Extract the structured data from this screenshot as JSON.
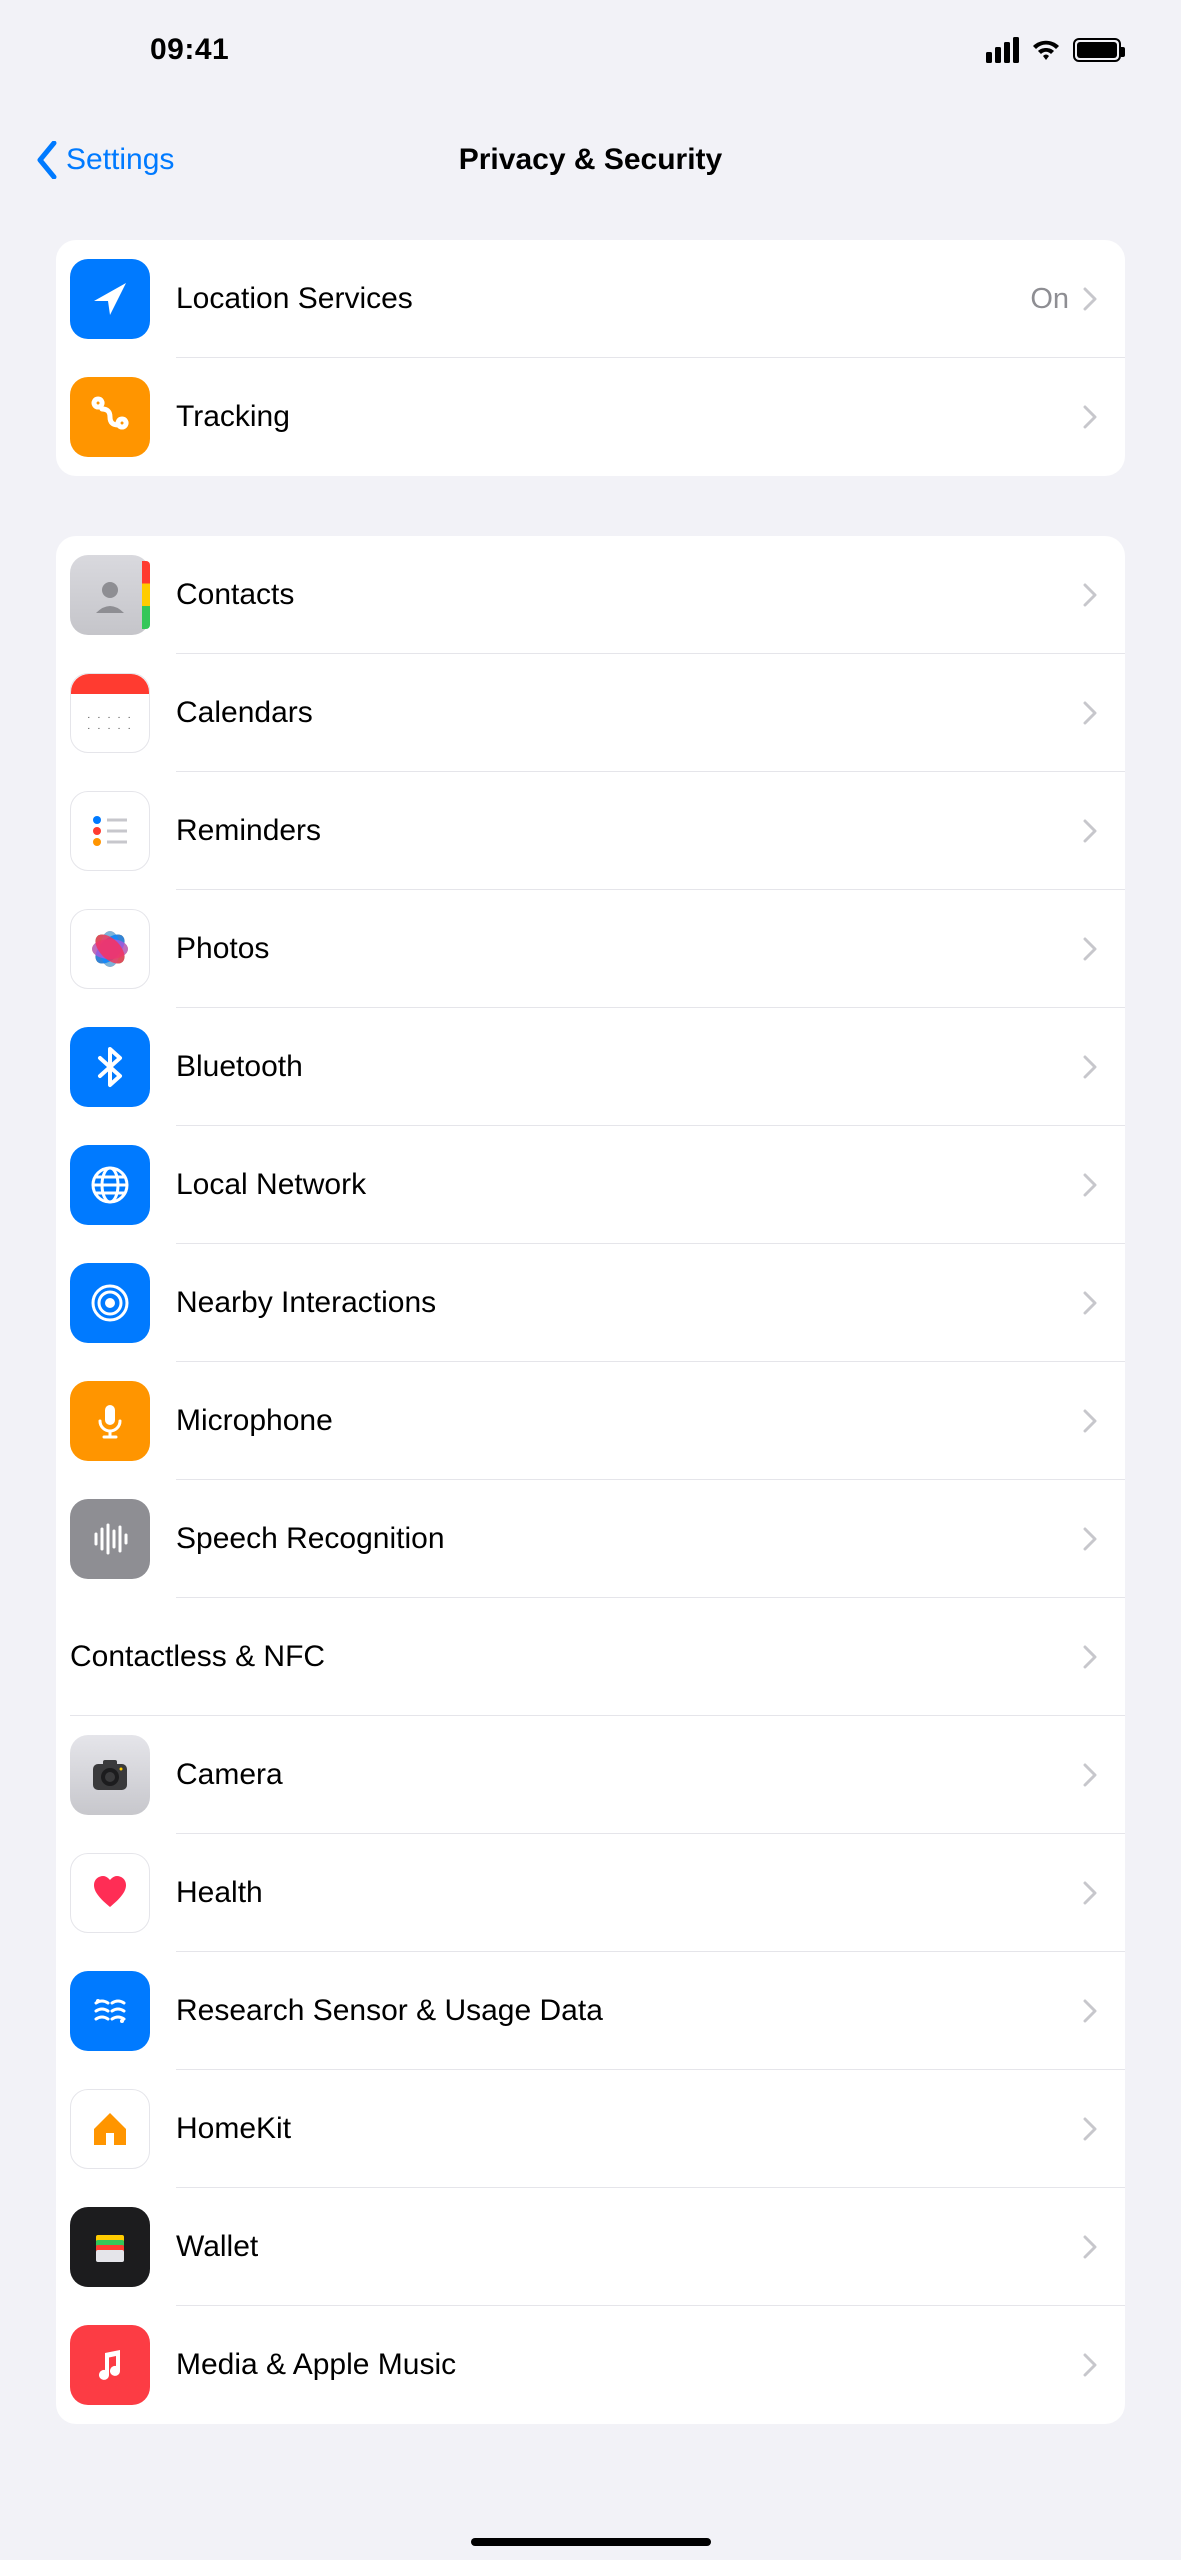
{
  "status": {
    "time": "09:41"
  },
  "nav": {
    "back": "Settings",
    "title": "Privacy & Security"
  },
  "group1": {
    "location": {
      "label": "Location Services",
      "value": "On"
    },
    "tracking": {
      "label": "Tracking"
    }
  },
  "group2": {
    "contacts": {
      "label": "Contacts"
    },
    "calendars": {
      "label": "Calendars"
    },
    "reminders": {
      "label": "Reminders"
    },
    "photos": {
      "label": "Photos"
    },
    "bluetooth": {
      "label": "Bluetooth"
    },
    "localnetwork": {
      "label": "Local Network"
    },
    "nearby": {
      "label": "Nearby Interactions"
    },
    "microphone": {
      "label": "Microphone"
    },
    "speech": {
      "label": "Speech Recognition"
    },
    "nfc": {
      "label": "Contactless & NFC"
    },
    "camera": {
      "label": "Camera"
    },
    "health": {
      "label": "Health"
    },
    "research": {
      "label": "Research Sensor & Usage Data"
    },
    "homekit": {
      "label": "HomeKit"
    },
    "wallet": {
      "label": "Wallet"
    },
    "media": {
      "label": "Media & Apple Music"
    }
  }
}
